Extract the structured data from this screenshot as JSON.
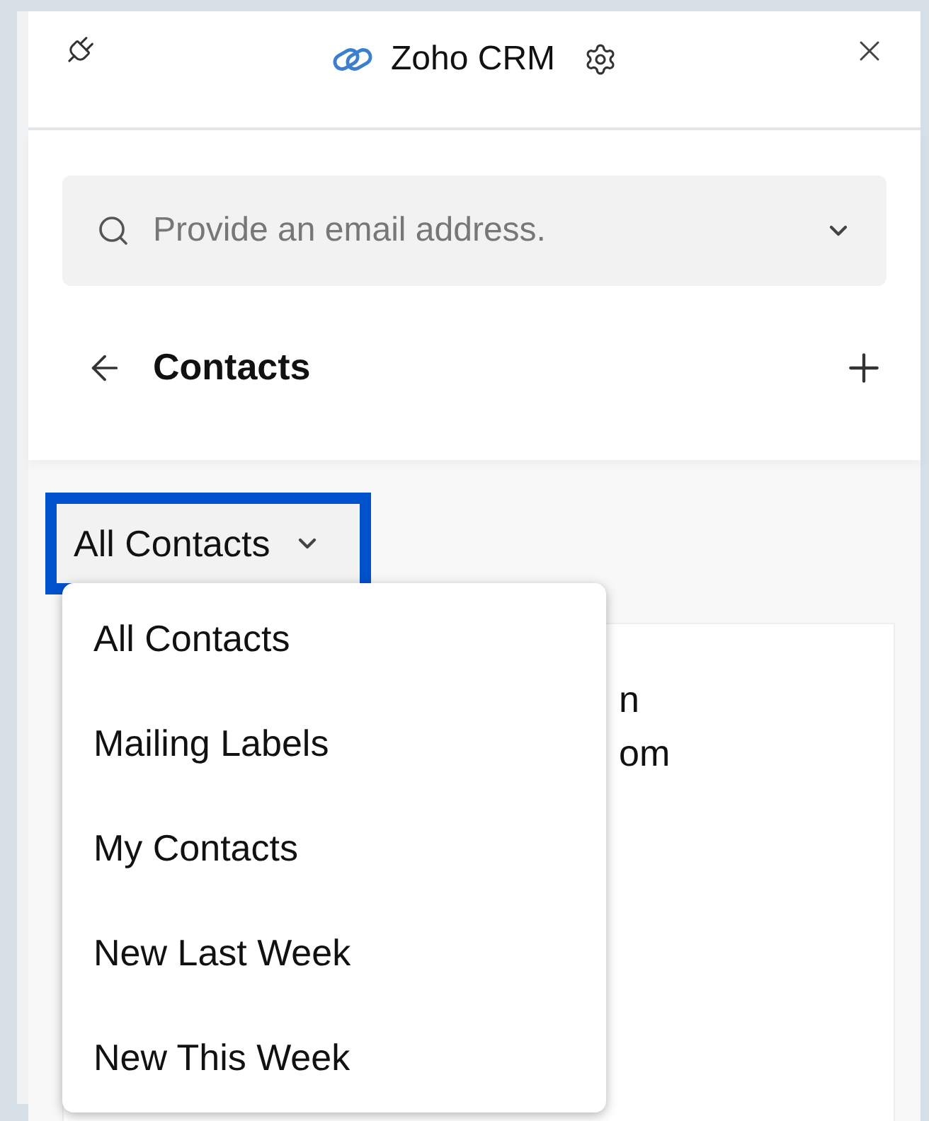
{
  "header": {
    "title": "Zoho CRM"
  },
  "search": {
    "placeholder": "Provide an email address."
  },
  "module": {
    "title": "Contacts"
  },
  "view_selector": {
    "label": "All Contacts",
    "expanded": true
  },
  "card": {
    "line_1": "n",
    "line_2": "om"
  },
  "menu": [
    {
      "label": "All Contacts",
      "selected": false
    },
    {
      "label": "Mailing Labels",
      "selected": false
    },
    {
      "label": "My Contacts",
      "selected": false
    },
    {
      "label": "New Last Week",
      "selected": false
    },
    {
      "label": "New This Week",
      "selected": false
    }
  ]
}
